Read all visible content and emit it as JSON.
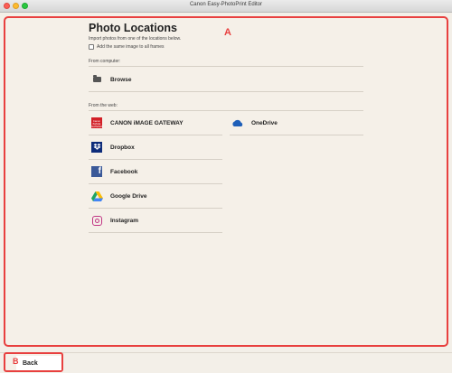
{
  "window": {
    "title": "Canon Easy-PhotoPrint Editor"
  },
  "callouts": {
    "a": "A",
    "b": "B"
  },
  "page": {
    "title": "Photo Locations",
    "subtitle": "Import photos from one of the locations below.",
    "checkbox_label": "Add the same image to all frames",
    "checkbox_checked": false
  },
  "from_computer": {
    "heading": "From computer:",
    "items": [
      {
        "label": "Browse",
        "icon": "folder-icon"
      }
    ]
  },
  "from_web": {
    "heading": "From the web:",
    "items": [
      {
        "label": "CANON iMAGE GATEWAY",
        "icon": "canon-image-gateway-icon",
        "icon_text": "Canon iMAGE GATEWAY"
      },
      {
        "label": "OneDrive",
        "icon": "onedrive-icon"
      },
      {
        "label": "Dropbox",
        "icon": "dropbox-icon"
      },
      {
        "label": "Facebook",
        "icon": "facebook-icon",
        "icon_text": "f"
      },
      {
        "label": "Google Drive",
        "icon": "google-drive-icon"
      },
      {
        "label": "Instagram",
        "icon": "instagram-icon"
      }
    ]
  },
  "footer": {
    "back_label": "Back"
  },
  "colors": {
    "highlight": "#e8403f",
    "background": "#f5f0e8",
    "canon_red": "#d21f26",
    "dropbox_blue": "#0d2c7a",
    "facebook_blue": "#3b5998",
    "onedrive_blue": "#1e5fb8"
  }
}
